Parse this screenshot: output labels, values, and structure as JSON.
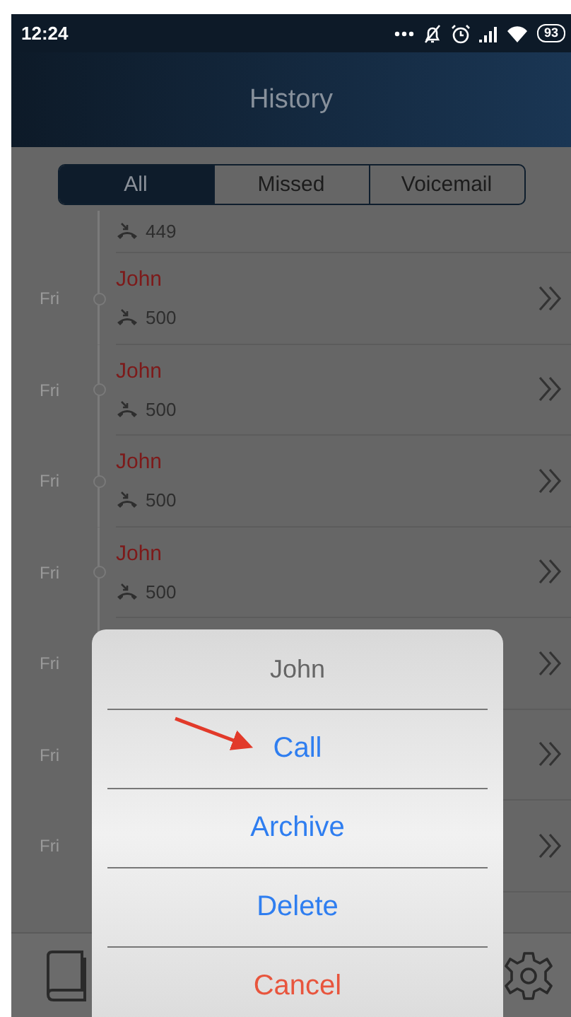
{
  "status_bar": {
    "time": "12:24",
    "battery": "93"
  },
  "header": {
    "title": "History"
  },
  "tabs": [
    {
      "label": "All",
      "selected": true
    },
    {
      "label": "Missed",
      "selected": false
    },
    {
      "label": "Voicemail",
      "selected": false
    }
  ],
  "history": [
    {
      "number": "449"
    },
    {
      "day": "Fri",
      "name": "John",
      "number": "500"
    },
    {
      "day": "Fri",
      "name": "John",
      "number": "500"
    },
    {
      "day": "Fri",
      "name": "John",
      "number": "500"
    },
    {
      "day": "Fri",
      "name": "John",
      "number": "500"
    },
    {
      "day": "Fri"
    },
    {
      "day": "Fri"
    },
    {
      "day": "Fri"
    }
  ],
  "action_sheet": {
    "title": "John",
    "actions": [
      {
        "label": "Call",
        "kind": "default",
        "pointed": true
      },
      {
        "label": "Archive",
        "kind": "default",
        "pointed": false
      },
      {
        "label": "Delete",
        "kind": "default",
        "pointed": false
      },
      {
        "label": "Cancel",
        "kind": "destructive",
        "pointed": false
      }
    ]
  }
}
